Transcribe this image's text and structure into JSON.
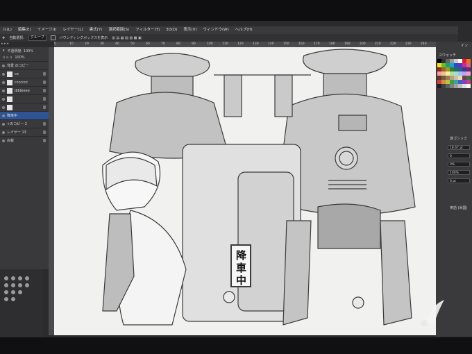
{
  "menu": [
    "ル(L)",
    "編集(E)",
    "イメージ(I)",
    "レイヤー(L)",
    "書式(Y)",
    "選択範囲(S)",
    "フィルター(T)",
    "3D(D)",
    "表示(V)",
    "ウィンドウ(W)",
    "ヘルプ(H)"
  ],
  "options": {
    "autoselect": "自動選択:",
    "group": "グループ",
    "bbox": "バウンディングボックスを表示"
  },
  "layers_panel": {
    "blend": "不透明度: 100%",
    "fill": "100%",
    "rows": [
      {
        "name": "背景 のコピー"
      },
      {
        "name": "ce"
      },
      {
        "name": "ccccccc"
      },
      {
        "name": "dddeeee"
      },
      {
        "name": ""
      },
      {
        "name": ""
      },
      {
        "name": "降車中"
      },
      {
        "name": "+のコピー 2"
      },
      {
        "name": "レイヤー 13"
      },
      {
        "name": "白板"
      }
    ]
  },
  "ruler_ticks": [
    "0",
    "10",
    "20",
    "30",
    "40",
    "50",
    "60",
    "70",
    "80",
    "90",
    "100",
    "110",
    "120",
    "130",
    "140",
    "150",
    "160",
    "170",
    "180",
    "190",
    "200",
    "210",
    "220",
    "230",
    "240"
  ],
  "right_panel": {
    "header": "スウォッチ",
    "font_name": "游ゴシック",
    "font_size": "18.67 pt",
    "field_a": "0",
    "field_b": "0%",
    "field_c": "100%",
    "field_d": "0 pt",
    "lang": "英語 (米国)",
    "top_label": "イン"
  },
  "canvas": {
    "sign_text": [
      "降",
      "車",
      "中"
    ]
  },
  "colors": {
    "swatches": [
      "#000000",
      "#333333",
      "#666666",
      "#999999",
      "#cccccc",
      "#ffffff",
      "#e02020",
      "#f07020",
      "#f0e020",
      "#60c030",
      "#20a060",
      "#20a0d0",
      "#2050d0",
      "#6030c0",
      "#c030a0",
      "#e06080",
      "#8a2a2a",
      "#a0602a",
      "#a09a2a",
      "#3a7a2a",
      "#2a6a5a",
      "#2a5a8a",
      "#3a3a8a",
      "#6a2a7a",
      "#f0a0a0",
      "#f0c090",
      "#f0f0a0",
      "#b0e0a0",
      "#a0e0d0",
      "#a0c0f0",
      "#c0a0f0",
      "#f0a0d0",
      "#5a3a2a",
      "#7a5a3a",
      "#9a7a5a",
      "#bba080",
      "#d0c0a0",
      "#e8dcc0",
      "#704040",
      "#407040",
      "#d04040",
      "#d09040",
      "#c0c040",
      "#40a040",
      "#40a0a0",
      "#4060c0",
      "#8040c0",
      "#c04080",
      "#202020",
      "#404040",
      "#606060",
      "#808080",
      "#a0a0a0",
      "#c0c0c0",
      "#e0e0e0",
      "#f8f8f8"
    ]
  }
}
